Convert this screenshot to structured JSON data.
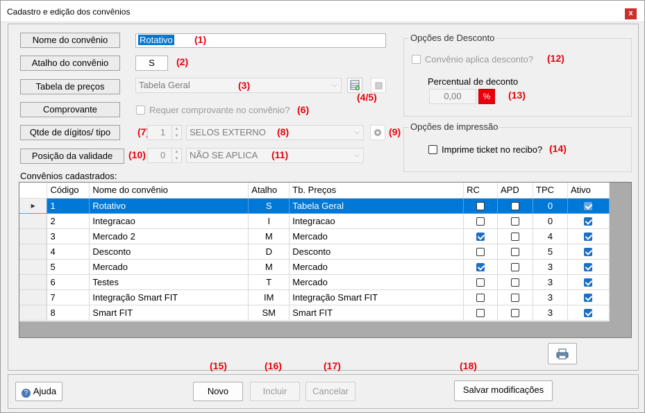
{
  "window": {
    "title": "Cadastro e edição dos convênios",
    "close_label": "x"
  },
  "form": {
    "nome_label": "Nome do convênio",
    "nome_value": "Rotativo",
    "atalho_label": "Atalho do convênio",
    "atalho_value": "S",
    "tabela_label": "Tabela de preços",
    "tabela_value": "Tabela Geral",
    "comprovante_label": "Comprovante",
    "comprovante_check_label": "Requer comprovante no convênio?",
    "digitos_label": "Qtde de dígitos/ tipo",
    "digitos_value": "1",
    "digitos_tipo": "SELOS EXTERNO",
    "validade_label": "Posição da validade",
    "validade_value": "0",
    "validade_tipo": "NÃO SE APLICA"
  },
  "desconto": {
    "title": "Opções de Desconto",
    "check_label": "Convênio aplica desconto?",
    "percentual_label": "Percentual de deconto",
    "percentual_value": "0,00",
    "percent_symbol": "%"
  },
  "impressao": {
    "title": "Opções de impressão",
    "check_label": "Imprime ticket no recibo?"
  },
  "markers": {
    "m1": "(1)",
    "m2": "(2)",
    "m3": "(3)",
    "m45": "(4/5)",
    "m6": "(6)",
    "m7": "(7)",
    "m8": "(8)",
    "m9": "(9)",
    "m10": "(10)",
    "m11": "(11)",
    "m12": "(12)",
    "m13": "(13)",
    "m14": "(14)",
    "m15": "(15)",
    "m16": "(16)",
    "m17": "(17)",
    "m18": "(18)"
  },
  "grid": {
    "caption": "Convênios cadastrados:",
    "columns": [
      "Código",
      "Nome do convênio",
      "Atalho",
      "Tb. Preços",
      "RC",
      "APD",
      "TPC",
      "Ativo"
    ],
    "rows": [
      {
        "codigo": "1",
        "nome": "Rotativo",
        "atalho": "S",
        "tabela": "Tabela Geral",
        "rc": false,
        "apd": false,
        "tpc": "0",
        "ativo": true,
        "selected": true
      },
      {
        "codigo": "2",
        "nome": "Integracao",
        "atalho": "I",
        "tabela": "Integracao",
        "rc": false,
        "apd": false,
        "tpc": "0",
        "ativo": true
      },
      {
        "codigo": "3",
        "nome": "Mercado 2",
        "atalho": "M",
        "tabela": "Mercado",
        "rc": true,
        "apd": false,
        "tpc": "4",
        "ativo": true
      },
      {
        "codigo": "4",
        "nome": "Desconto",
        "atalho": "D",
        "tabela": "Desconto",
        "rc": false,
        "apd": false,
        "tpc": "5",
        "ativo": true
      },
      {
        "codigo": "5",
        "nome": "Mercado",
        "atalho": "M",
        "tabela": "Mercado",
        "rc": true,
        "apd": false,
        "tpc": "3",
        "ativo": true
      },
      {
        "codigo": "6",
        "nome": "Testes",
        "atalho": "T",
        "tabela": "Mercado",
        "rc": false,
        "apd": false,
        "tpc": "3",
        "ativo": true
      },
      {
        "codigo": "7",
        "nome": "Integração Smart FIT",
        "atalho": "IM",
        "tabela": "Integração Smart FIT",
        "rc": false,
        "apd": false,
        "tpc": "3",
        "ativo": true
      },
      {
        "codigo": "8",
        "nome": "Smart FIT",
        "atalho": "SM",
        "tabela": "Smart FIT",
        "rc": false,
        "apd": false,
        "tpc": "3",
        "ativo": true
      }
    ]
  },
  "footer": {
    "ajuda": "Ajuda",
    "novo": "Novo",
    "incluir": "Incluir",
    "cancelar": "Cancelar",
    "salvar": "Salvar modificações"
  },
  "colors": {
    "accent": "#0078d7",
    "marker_red": "#e8000b",
    "percent_bg": "#e8000b"
  }
}
